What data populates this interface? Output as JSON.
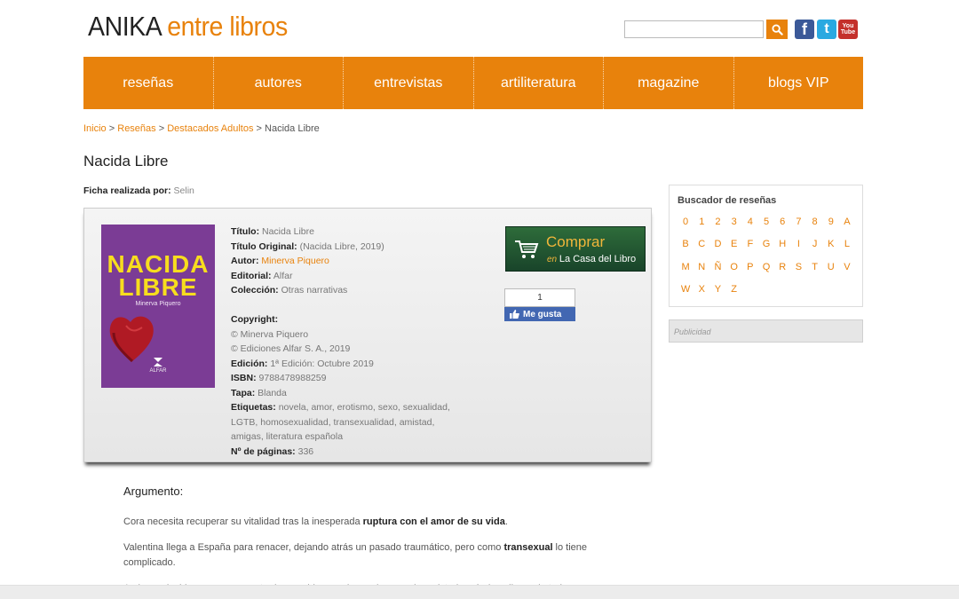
{
  "header": {
    "logo_part1": "ANIKA",
    "logo_part2": "entre libros",
    "search_placeholder": "",
    "social": {
      "facebook": "f",
      "twitter": "t",
      "youtube_top": "You",
      "youtube_bottom": "Tube"
    }
  },
  "nav": {
    "items": [
      "reseñas",
      "autores",
      "entrevistas",
      "artiliteratura",
      "magazine",
      "blogs VIP"
    ]
  },
  "breadcrumb": {
    "home": "Inicio",
    "sep": ">",
    "resenas": "Reseñas",
    "destacados": "Destacados Adultos",
    "current": "Nacida Libre"
  },
  "page_title": "Nacida Libre",
  "ficha": {
    "label": "Ficha realizada por:",
    "value": "Selin"
  },
  "cover": {
    "title_line1": "NACIDA",
    "title_line2": "LIBRE",
    "author": "Minerva Piquero",
    "publisher": "ALFAR"
  },
  "book": {
    "titulo_label": "Título:",
    "titulo": "Nacida Libre",
    "titulo_original_label": "Título Original:",
    "titulo_original": "(Nacida Libre, 2019)",
    "autor_label": "Autor:",
    "autor": "Minerva Piquero",
    "editorial_label": "Editorial:",
    "editorial": "Alfar",
    "coleccion_label": "Colección:",
    "coleccion": "Otras narrativas",
    "copyright_label": "Copyright:",
    "copyright_1": "© Minerva Piquero",
    "copyright_2": "© Ediciones Alfar S. A., 2019",
    "edicion_label": "Edición:",
    "edicion": "1ª Edición: Octubre 2019",
    "isbn_label": "ISBN:",
    "isbn": "9788478988259",
    "tapa_label": "Tapa:",
    "tapa": "Blanda",
    "etiquetas_label": "Etiquetas:",
    "etiquetas_1": "novela, amor, erotismo, sexo, sexualidad,",
    "etiquetas_2": "LGTB, homosexualidad, transexualidad, amistad,",
    "etiquetas_3": "amigas, literatura española",
    "paginas_label": "Nº de páginas:",
    "paginas": "336"
  },
  "buy": {
    "label": "Comprar",
    "en": "en",
    "store": "La Casa del Libro"
  },
  "like": {
    "count": "1",
    "label": "Me gusta"
  },
  "argumento": {
    "title": "Argumento:",
    "p1_a": "Cora necesita recuperar su vitalidad tras la inesperada ",
    "p1_b": "ruptura con el amor de su vida",
    "p1_c": ".",
    "p2_a": "Valentina llega a España para renacer, dejando atrás un pasado traumático, pero como ",
    "p2_b": "transexual",
    "p2_c": " lo tiene complicado.",
    "p3": "Ambas coinciden en un momento de sus vidas en el que el amor y la amistad serán los pilares de todo"
  },
  "sidebar": {
    "title": "Buscador de reseñas",
    "letters": [
      "0",
      "1",
      "2",
      "3",
      "4",
      "5",
      "6",
      "7",
      "8",
      "9",
      "A",
      "B",
      "C",
      "D",
      "E",
      "F",
      "G",
      "H",
      "I",
      "J",
      "K",
      "L",
      "M",
      "N",
      "Ñ",
      "O",
      "P",
      "Q",
      "R",
      "S",
      "T",
      "U",
      "V",
      "W",
      "X",
      "Y",
      "Z"
    ],
    "publicidad": "Publicidad"
  },
  "colors": {
    "accent": "#e8820c",
    "nav_text": "#ffffff",
    "cover_bg": "#7b3c95",
    "cover_title": "#f7dd1e",
    "buy_bg": "#1f4f2e",
    "fb_blue": "#4267b2"
  }
}
